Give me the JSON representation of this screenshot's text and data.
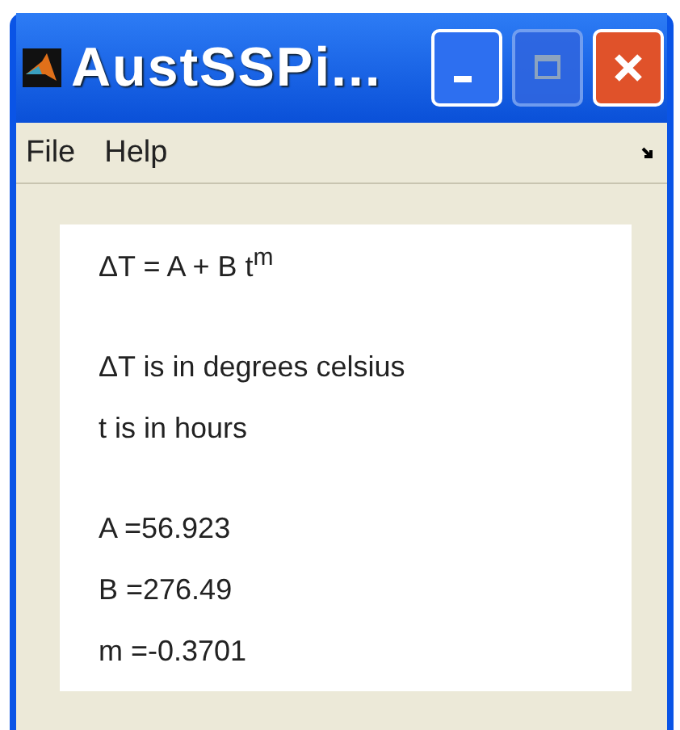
{
  "window": {
    "title": "AustSSPi..."
  },
  "menu": [
    "File",
    "Help"
  ],
  "panel": {
    "formula": "ΔT = A + B t$^{m}$",
    "units": [
      "ΔT is in degrees celsius",
      "t is in hours"
    ],
    "params": [
      "A =56.923",
      "B =276.49",
      "m =-0.3701"
    ]
  }
}
